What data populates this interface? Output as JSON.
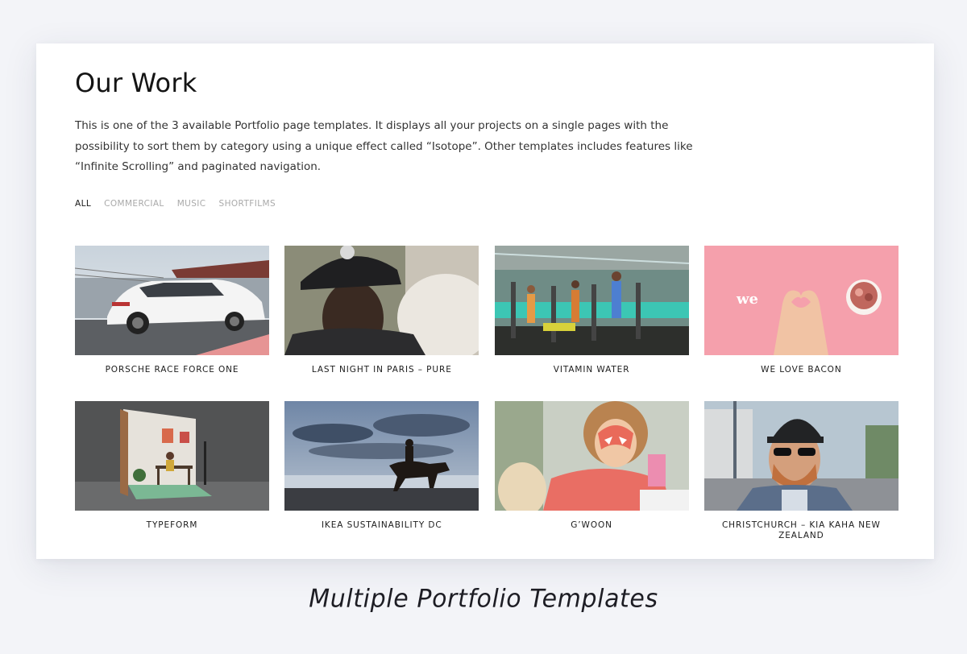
{
  "header": {
    "title": "Our Work",
    "intro": "This is one of the 3 available Portfolio page templates. It displays all your projects on a single pages with the possibility to sort them by category using a unique effect called “Isotope”. Other templates includes features like “Infinite Scrolling” and paginated navigation."
  },
  "filters": [
    {
      "label": "ALL",
      "active": true
    },
    {
      "label": "COMMERCIAL",
      "active": false
    },
    {
      "label": "MUSIC",
      "active": false
    },
    {
      "label": "SHORTFILMS",
      "active": false
    }
  ],
  "projects": [
    {
      "title": "PORSCHE RACE FORCE ONE",
      "thumb": "white-suv-on-racetrack-image"
    },
    {
      "title": "LAST NIGHT IN PARIS – PURE",
      "thumb": "man-in-cap-portrait-image"
    },
    {
      "title": "VITAMIN WATER",
      "thumb": "gym-treadmills-image"
    },
    {
      "title": "WE LOVE BACON",
      "thumb": "pink-heart-hands-bacon-image"
    },
    {
      "title": "TYPEFORM",
      "thumb": "room-set-with-desk-image"
    },
    {
      "title": "IKEA SUSTAINABILITY DC",
      "thumb": "horse-rider-on-beach-image"
    },
    {
      "title": "G’WOON",
      "thumb": "child-face-paint-image"
    },
    {
      "title": "CHRISTCHURCH – KIA KAHA NEW ZEALAND",
      "thumb": "bearded-man-sunglasses-image"
    }
  ],
  "footer": {
    "tagline": "Multiple  Portfolio  Templates"
  },
  "colors": {
    "background": "#f3f4f8",
    "card": "#ffffff",
    "text": "#1a1a1a",
    "filter_inactive": "#a9a9a9",
    "bacon_pink": "#f5a0ac"
  }
}
